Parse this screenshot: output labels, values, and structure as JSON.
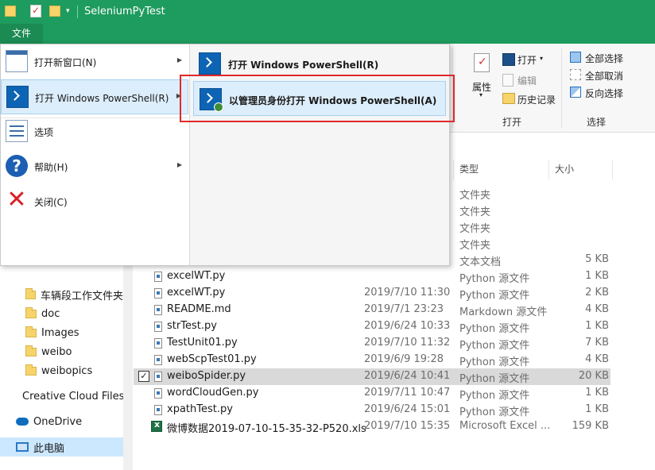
{
  "window": {
    "title": "SeleniumPyTest"
  },
  "file_tab": "文件",
  "file_menu": {
    "items": [
      {
        "label": "打开新窗口(N)",
        "has_submenu": true
      },
      {
        "label": "打开 Windows PowerShell(R)",
        "has_submenu": true
      },
      {
        "label": "选项",
        "has_submenu": false
      },
      {
        "label": "帮助(H)",
        "has_submenu": true
      },
      {
        "label": "关闭(C)",
        "has_submenu": false
      }
    ],
    "submenu": [
      {
        "label": "打开 Windows PowerShell(R)"
      },
      {
        "label": "以管理员身份打开 Windows PowerShell(A)"
      }
    ]
  },
  "ribbon": {
    "properties": "属性",
    "open": "打开",
    "edit": "编辑",
    "history": "历史记录",
    "open_group": "打开",
    "select_all": "全部选择",
    "select_none": "全部取消",
    "invert": "反向选择",
    "select_group": "选择"
  },
  "columns": {
    "type": "类型",
    "size": "大小"
  },
  "files": [
    {
      "name": "",
      "date": "",
      "type": "文件夹",
      "size": ""
    },
    {
      "name": "",
      "date": "",
      "type": "文件夹",
      "size": ""
    },
    {
      "name": "",
      "date": "",
      "type": "文件夹",
      "size": ""
    },
    {
      "name": "",
      "date": "",
      "type": "文件夹",
      "size": ""
    },
    {
      "name": "",
      "date": "",
      "type": "文本文档",
      "size": "5 KB"
    },
    {
      "name": "excelWT.py",
      "date": "",
      "type": "Python 源文件",
      "size": "1 KB"
    },
    {
      "name": "excelWT.py",
      "date": "2019/7/10 11:30",
      "type": "Python 源文件",
      "size": "2 KB"
    },
    {
      "name": "README.md",
      "date": "2019/7/1 23:23",
      "type": "Markdown 源文件",
      "size": "4 KB"
    },
    {
      "name": "strTest.py",
      "date": "2019/6/24 10:33",
      "type": "Python 源文件",
      "size": "1 KB"
    },
    {
      "name": "TestUnit01.py",
      "date": "2019/7/10 11:32",
      "type": "Python 源文件",
      "size": "7 KB"
    },
    {
      "name": "webScpTest01.py",
      "date": "2019/6/9 19:28",
      "type": "Python 源文件",
      "size": "4 KB"
    },
    {
      "name": "weiboSpider.py",
      "date": "2019/6/24 10:41",
      "type": "Python 源文件",
      "size": "20 KB"
    },
    {
      "name": "wordCloudGen.py",
      "date": "2019/7/11 10:47",
      "type": "Python 源文件",
      "size": "1 KB"
    },
    {
      "name": "xpathTest.py",
      "date": "2019/6/24 15:01",
      "type": "Python 源文件",
      "size": "1 KB"
    },
    {
      "name": "微博数据2019-07-10-15-35-32-P520.xls",
      "date": "2019/7/10 15:35",
      "type": "Microsoft Excel ...",
      "size": "159 KB"
    }
  ],
  "nav": [
    {
      "label": "车辆段工作文件夹"
    },
    {
      "label": "doc"
    },
    {
      "label": "Images"
    },
    {
      "label": "weibo"
    },
    {
      "label": "weibopics"
    },
    {
      "label": "Creative Cloud Files"
    },
    {
      "label": "OneDrive"
    },
    {
      "label": "此电脑"
    }
  ]
}
